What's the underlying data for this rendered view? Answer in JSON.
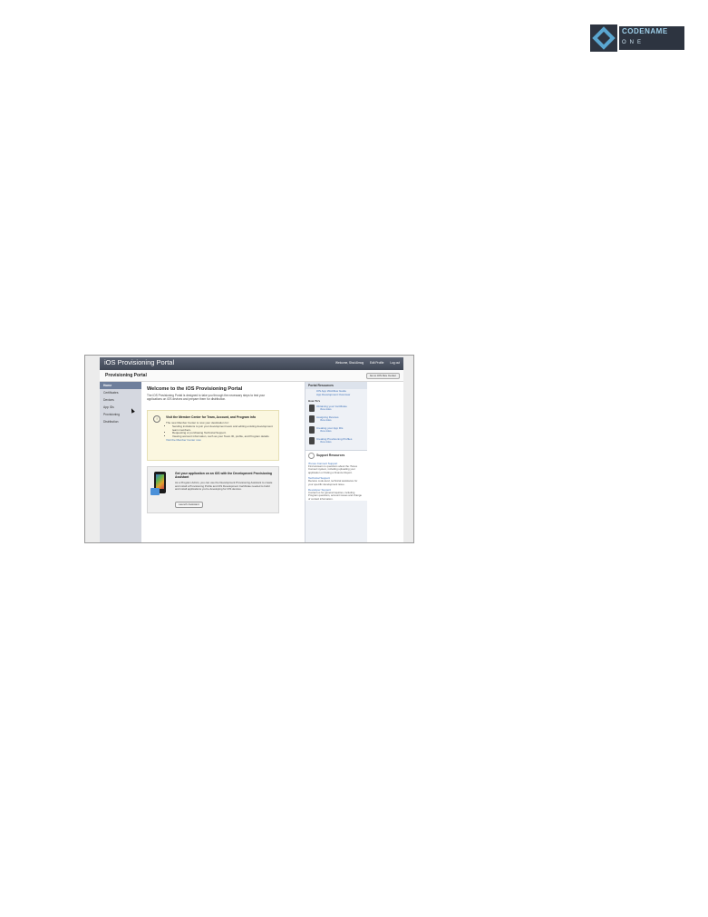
{
  "logo": {
    "line1": "CODENAME",
    "line2": "ONE"
  },
  "portal": {
    "header_title": "iOS Provisioning Portal",
    "header_links": [
      "Welcome, Shai Almog",
      "Edit Profile",
      "Log out"
    ],
    "breadcrumb_title": "Provisioning Portal",
    "goto_button": "Go to iOS Dev Center",
    "nav": [
      "Home",
      "Certificates",
      "Devices",
      "App IDs",
      "Provisioning",
      "Distribution"
    ],
    "welcome_title": "Welcome to the iOS Provisioning Portal",
    "welcome_text": "The iOS Provisioning Portal is designed to take you through the necessary steps to test your applications on iOS devices and prepare them for distribution.",
    "notice": {
      "icon": "info-icon",
      "title": "Visit the Member Center for Team, Account, and Program info",
      "lead": "The new Member Center is now your destination for:",
      "bullets": [
        "Sending invitations to join your development team and editing existing development team members.",
        "Requesting or purchasing Technical Support.",
        "Viewing account information, such as your Team ID, profile, and Program details."
      ],
      "link": "Visit the Member Center now"
    },
    "assistant": {
      "title": "Get your application on an iOS with the Development Provisioning Assistant",
      "text": "As a Program Admin, you can use the Development Provisioning Assistant to create and install a Provisioning Profile and iOS Development Certificate needed to build and install applications you're developing for iOS devices.",
      "button": "Launch Assistant"
    },
    "resources": {
      "title": "Portal Resources",
      "links": [
        "iOS App Workflow Guide",
        "App Development Overview"
      ],
      "new_label": "How-To's",
      "videos": [
        {
          "title": "Obtaining your Certificate",
          "sub": "View video"
        },
        {
          "title": "Assigning Devices",
          "sub": "View video"
        },
        {
          "title": "Creating your App IDs",
          "sub": "View video"
        },
        {
          "title": "Creating Provisioning Profiles",
          "sub": "View video"
        }
      ]
    },
    "support": {
      "title": "Support Resources",
      "items": [
        {
          "title": "iTunes Connect Support",
          "text": "Find answers to questions about the iTunes Connect system, including uploading your application or finding a Finance Report."
        },
        {
          "title": "Technical Support",
          "text": "Receive code-level, technical assistance for your specific development issue."
        },
        {
          "title": "Developer Support",
          "text": "Contact us for general inquiries, including Program questions, account issues and change of contact information."
        }
      ]
    }
  }
}
